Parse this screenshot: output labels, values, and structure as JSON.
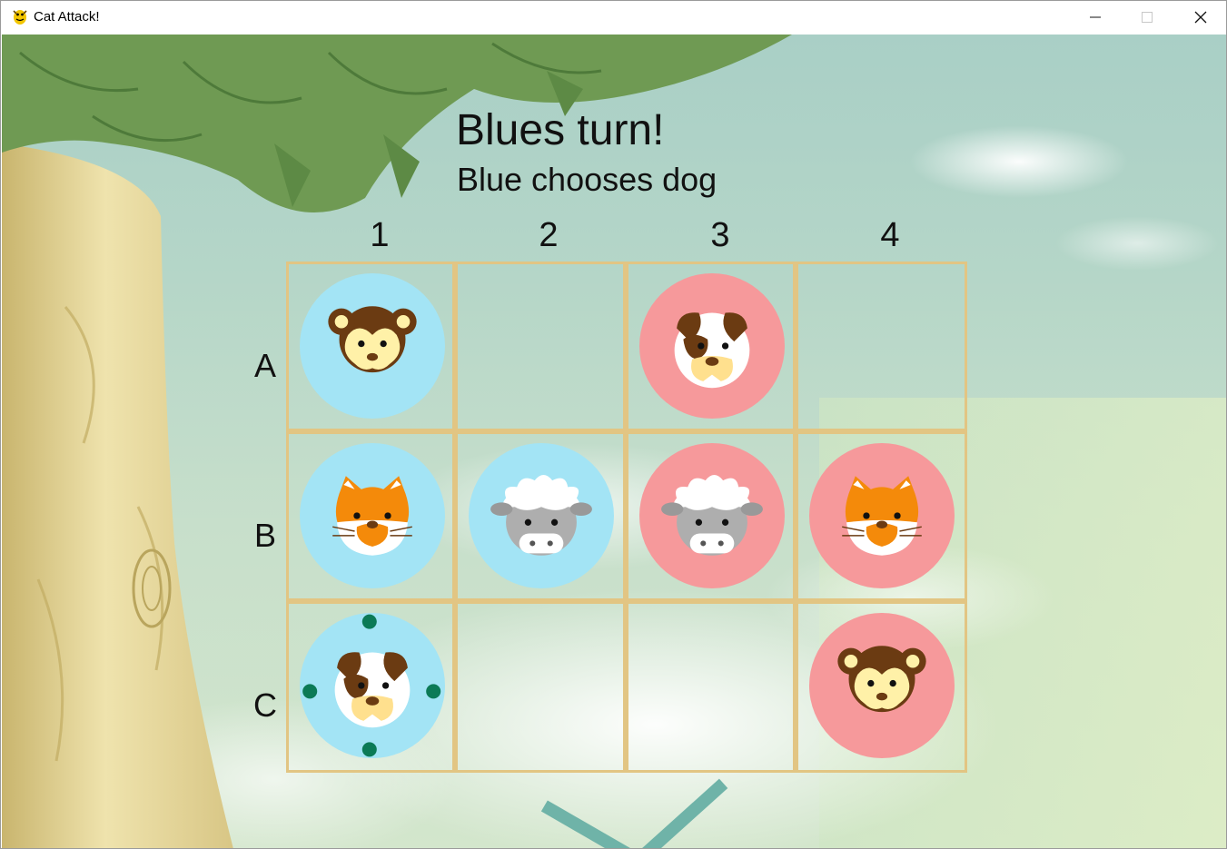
{
  "window": {
    "title": "Cat Attack!"
  },
  "game": {
    "heading": "Blues turn!",
    "subheading": "Blue chooses dog",
    "columns": [
      "1",
      "2",
      "3",
      "4"
    ],
    "rows": [
      "A",
      "B",
      "C"
    ],
    "colors": {
      "blue": "#a3e4f5",
      "red": "#f6999b",
      "grid_line": "#e2c583"
    },
    "board": [
      [
        {
          "animal": "monkey",
          "team": "blue"
        },
        null,
        {
          "animal": "dog",
          "team": "red"
        },
        null
      ],
      [
        {
          "animal": "cat",
          "team": "blue"
        },
        {
          "animal": "sheep",
          "team": "blue"
        },
        {
          "animal": "sheep",
          "team": "red"
        },
        {
          "animal": "cat",
          "team": "red"
        }
      ],
      [
        {
          "animal": "dog",
          "team": "blue",
          "selected": true
        },
        null,
        null,
        {
          "animal": "monkey",
          "team": "red"
        }
      ]
    ]
  }
}
